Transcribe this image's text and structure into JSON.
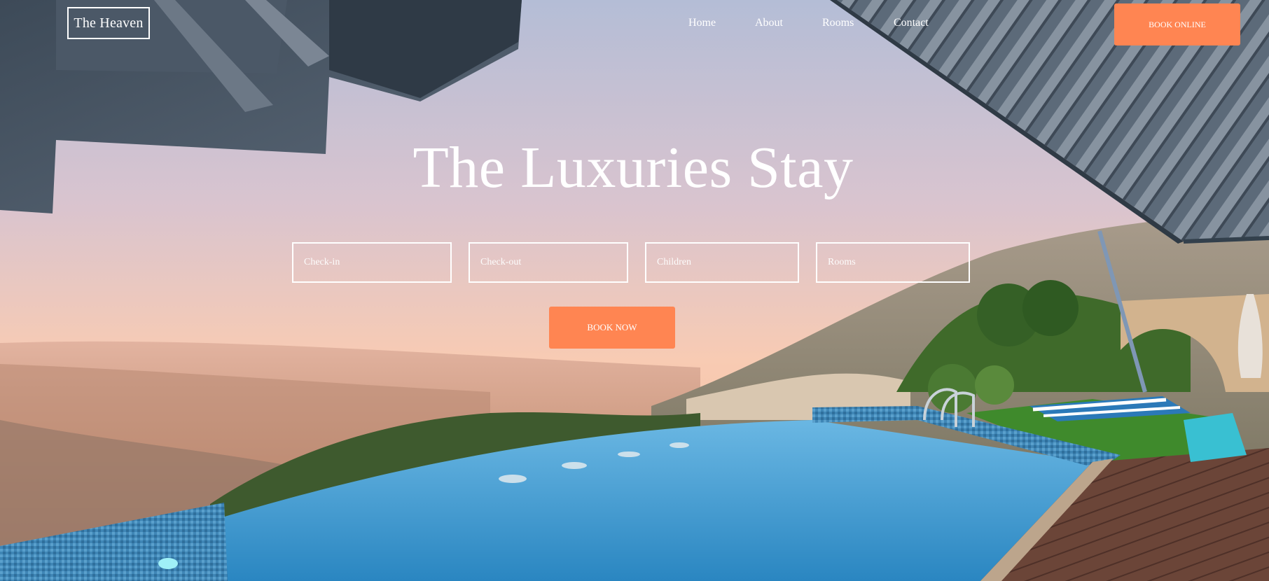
{
  "brand": {
    "name": "The Heaven"
  },
  "nav": {
    "items": [
      {
        "label": "Home"
      },
      {
        "label": "About"
      },
      {
        "label": "Rooms"
      },
      {
        "label": "Contact"
      }
    ],
    "book_online_label": "BOOK ONLINE"
  },
  "hero": {
    "title": "The Luxuries Stay",
    "fields": {
      "checkin_placeholder": "Check-in",
      "checkout_placeholder": "Check-out",
      "children_placeholder": "Children",
      "rooms_placeholder": "Rooms"
    },
    "book_now_label": "BOOK NOW"
  },
  "colors": {
    "accent": "#ff8552",
    "sky_top": "#b9c0d6",
    "sky_bottom": "#f6c7ae",
    "pool": "#3d9ad1"
  }
}
